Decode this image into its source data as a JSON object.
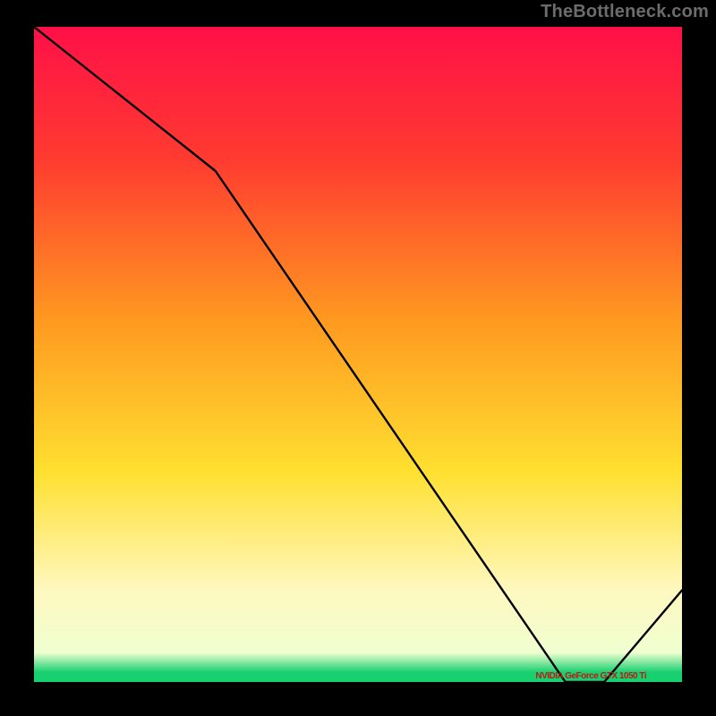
{
  "watermark": "TheBottleneck.com",
  "annotation_label": "NVIDIA GeForce GTX 1050 Ti",
  "colors": {
    "top": "#ff1040",
    "mid_red": "#ff3a30",
    "orange": "#ff8a20",
    "yellow": "#ffe030",
    "pale": "#fff8c0",
    "green": "#18d070",
    "line": "#000000",
    "frame": "#000000"
  },
  "chart_data": {
    "type": "line",
    "title": "",
    "xlabel": "",
    "ylabel": "",
    "xlim": [
      0,
      100
    ],
    "ylim": [
      0,
      100
    ],
    "x": [
      0,
      28,
      82,
      88,
      100
    ],
    "values": [
      100,
      78,
      0,
      0,
      14
    ],
    "annotation": {
      "text": "NVIDIA GeForce GTX 1050 Ti",
      "x_range": [
        80,
        90
      ],
      "y": 0
    },
    "gradient_stops": [
      {
        "pos": 0.0,
        "color": "#ff1048"
      },
      {
        "pos": 0.2,
        "color": "#ff3a30"
      },
      {
        "pos": 0.45,
        "color": "#ff9a20"
      },
      {
        "pos": 0.68,
        "color": "#ffe030"
      },
      {
        "pos": 0.86,
        "color": "#fff8c0"
      },
      {
        "pos": 0.955,
        "color": "#f0ffd0"
      },
      {
        "pos": 0.985,
        "color": "#18d070"
      },
      {
        "pos": 1.0,
        "color": "#18d070"
      }
    ]
  }
}
